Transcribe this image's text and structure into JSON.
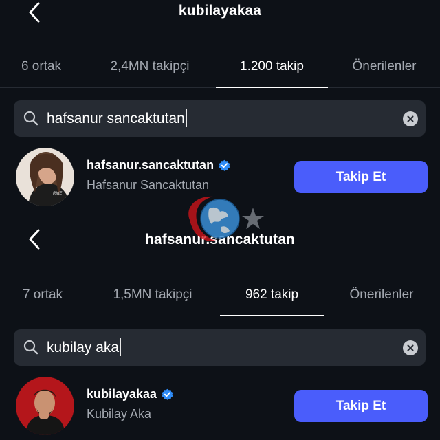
{
  "panels": [
    {
      "title": "kubilayakaa",
      "tabs": [
        {
          "label": "6 ortak"
        },
        {
          "label": "2,4MN takipçi"
        },
        {
          "label": "1.200 takip"
        },
        {
          "label": "Önerilenler"
        }
      ],
      "active_tab": "1.200 takip",
      "search": {
        "value": "hafsanur sancaktutan"
      },
      "result": {
        "username": "hafsanur.sancaktutan",
        "full_name": "Hafsanur Sancaktutan",
        "verified": true,
        "button_label": "Takip Et"
      }
    },
    {
      "title": "hafsanur.sancaktutan",
      "tabs": [
        {
          "label": "7 ortak"
        },
        {
          "label": "1,5MN takipçi"
        },
        {
          "label": "962 takip"
        },
        {
          "label": "Önerilenler"
        }
      ],
      "active_tab": "962 takip",
      "search": {
        "value": "kubilay aka"
      },
      "result": {
        "username": "kubilayakaa",
        "full_name": "Kubilay Aka",
        "verified": true,
        "button_label": "Takip Et"
      }
    }
  ],
  "icons": {
    "back": "chevron-left-icon",
    "search": "search-icon",
    "clear": "clear-circle-icon",
    "verified": "verified-badge-icon"
  },
  "colors": {
    "background": "#0d1117",
    "search_field": "#262b33",
    "follow_button": "#4a5dfb",
    "verified_badge": "#2f8cf7",
    "secondary_text": "#a4a9b1"
  }
}
